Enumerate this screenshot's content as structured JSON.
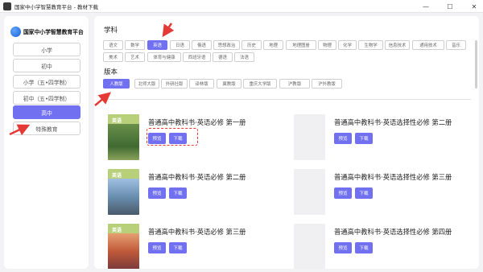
{
  "window": {
    "title": "国家中小学智慧教育平台 - 教材下载",
    "controls": [
      "—",
      "☐",
      "✕"
    ]
  },
  "sidebar": {
    "logo_text": "国家中小学智慧教育平台",
    "items": [
      {
        "label": "小学",
        "active": false
      },
      {
        "label": "初中",
        "active": false
      },
      {
        "label": "小学（五•四学制）",
        "active": false
      },
      {
        "label": "初中（五•四学制）",
        "active": false
      },
      {
        "label": "高中",
        "active": true
      },
      {
        "label": "特殊教育",
        "active": false
      }
    ]
  },
  "subject": {
    "title": "学科",
    "row1": [
      "语文",
      "数学",
      "英语",
      "日语",
      "俄语",
      "思想政治",
      "历史",
      "地理",
      "地理图册",
      "物理",
      "化学",
      "生物学",
      "信息技术",
      "通用技术",
      "音乐"
    ],
    "row2": [
      "美术",
      "艺术",
      "体育与健康",
      "西班牙语",
      "德语",
      "法语"
    ],
    "active": "英语"
  },
  "edition": {
    "title": "版本",
    "items": [
      "人教版",
      "北师大版",
      "外研社版",
      "译林版",
      "冀教版",
      "重庆大学版",
      "沪教版",
      "沪外教版"
    ],
    "active": "人教版"
  },
  "books": [
    {
      "title": "普通高中教科书·英语必修 第一册",
      "preview": "预览",
      "download": "下载",
      "cover": "英语"
    },
    {
      "title": "普通高中教科书·英语选择性必修 第二册",
      "preview": "预览",
      "download": "下载",
      "cover": ""
    },
    {
      "title": "普通高中教科书·英语必修 第二册",
      "preview": "预览",
      "download": "下载",
      "cover": "英语"
    },
    {
      "title": "普通高中教科书·英语选择性必修 第三册",
      "preview": "预览",
      "download": "下载",
      "cover": ""
    },
    {
      "title": "普通高中教科书·英语必修 第三册",
      "preview": "预览",
      "download": "下载",
      "cover": "英语"
    },
    {
      "title": "普通高中教科书·英语选择性必修 第四册",
      "preview": "预览",
      "download": "下载",
      "cover": ""
    }
  ],
  "colors": {
    "accent": "#7070f0",
    "annotation": "#e53935"
  }
}
